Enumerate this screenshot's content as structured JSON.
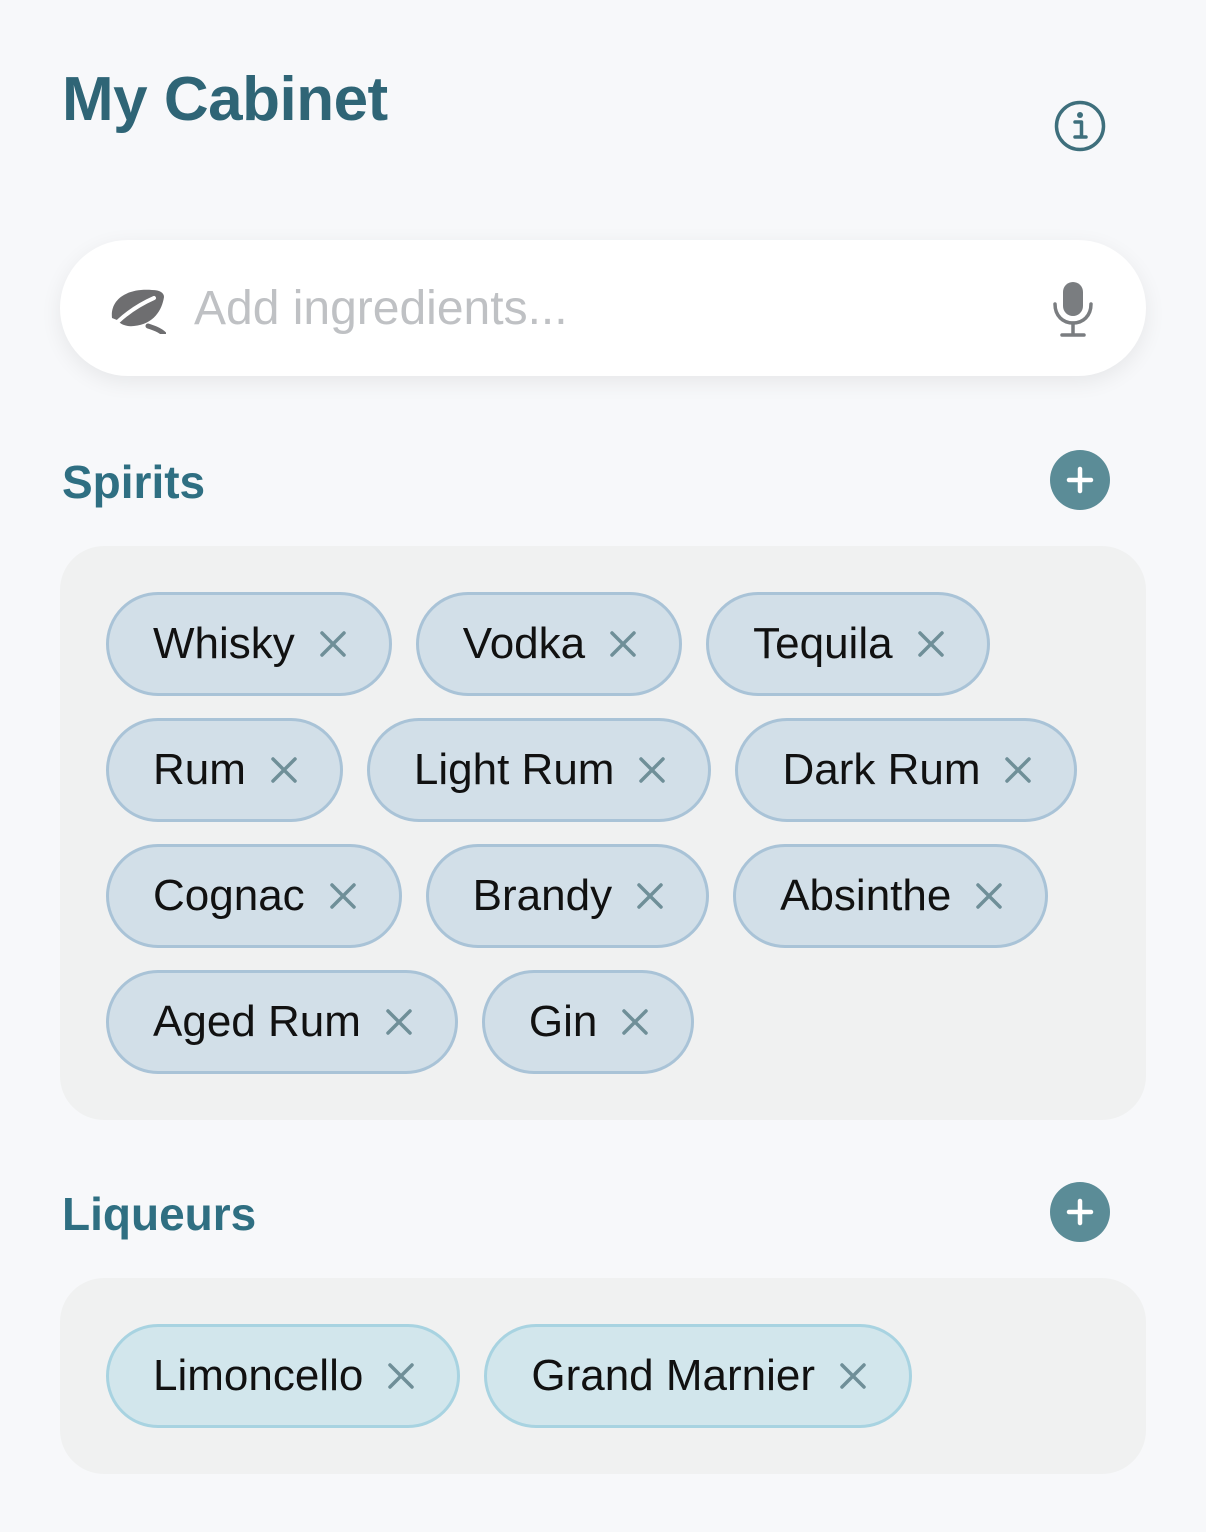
{
  "header": {
    "title": "My Cabinet",
    "info_icon": "info-icon"
  },
  "search": {
    "placeholder": "Add ingredients...",
    "value": "",
    "leading_icon": "leaf-icon",
    "trailing_icon": "microphone-icon"
  },
  "sections": [
    {
      "title": "Spirits",
      "add_icon": "plus-icon",
      "items": [
        "Whisky",
        "Vodka",
        "Tequila",
        "Rum",
        "Light Rum",
        "Dark Rum",
        "Cognac",
        "Brandy",
        "Absinthe",
        "Aged Rum",
        "Gin"
      ]
    },
    {
      "title": "Liqueurs",
      "add_icon": "plus-icon",
      "items": [
        "Limoncello",
        "Grand Marnier"
      ]
    }
  ],
  "colors": {
    "title": "#2f6576",
    "section_title": "#2f6f82",
    "add_button": "#5b8c97",
    "spirit_chip": "#d2dfe8",
    "liqueur_chip": "#d2e6ec",
    "remove_icon": "#6f8f98"
  }
}
